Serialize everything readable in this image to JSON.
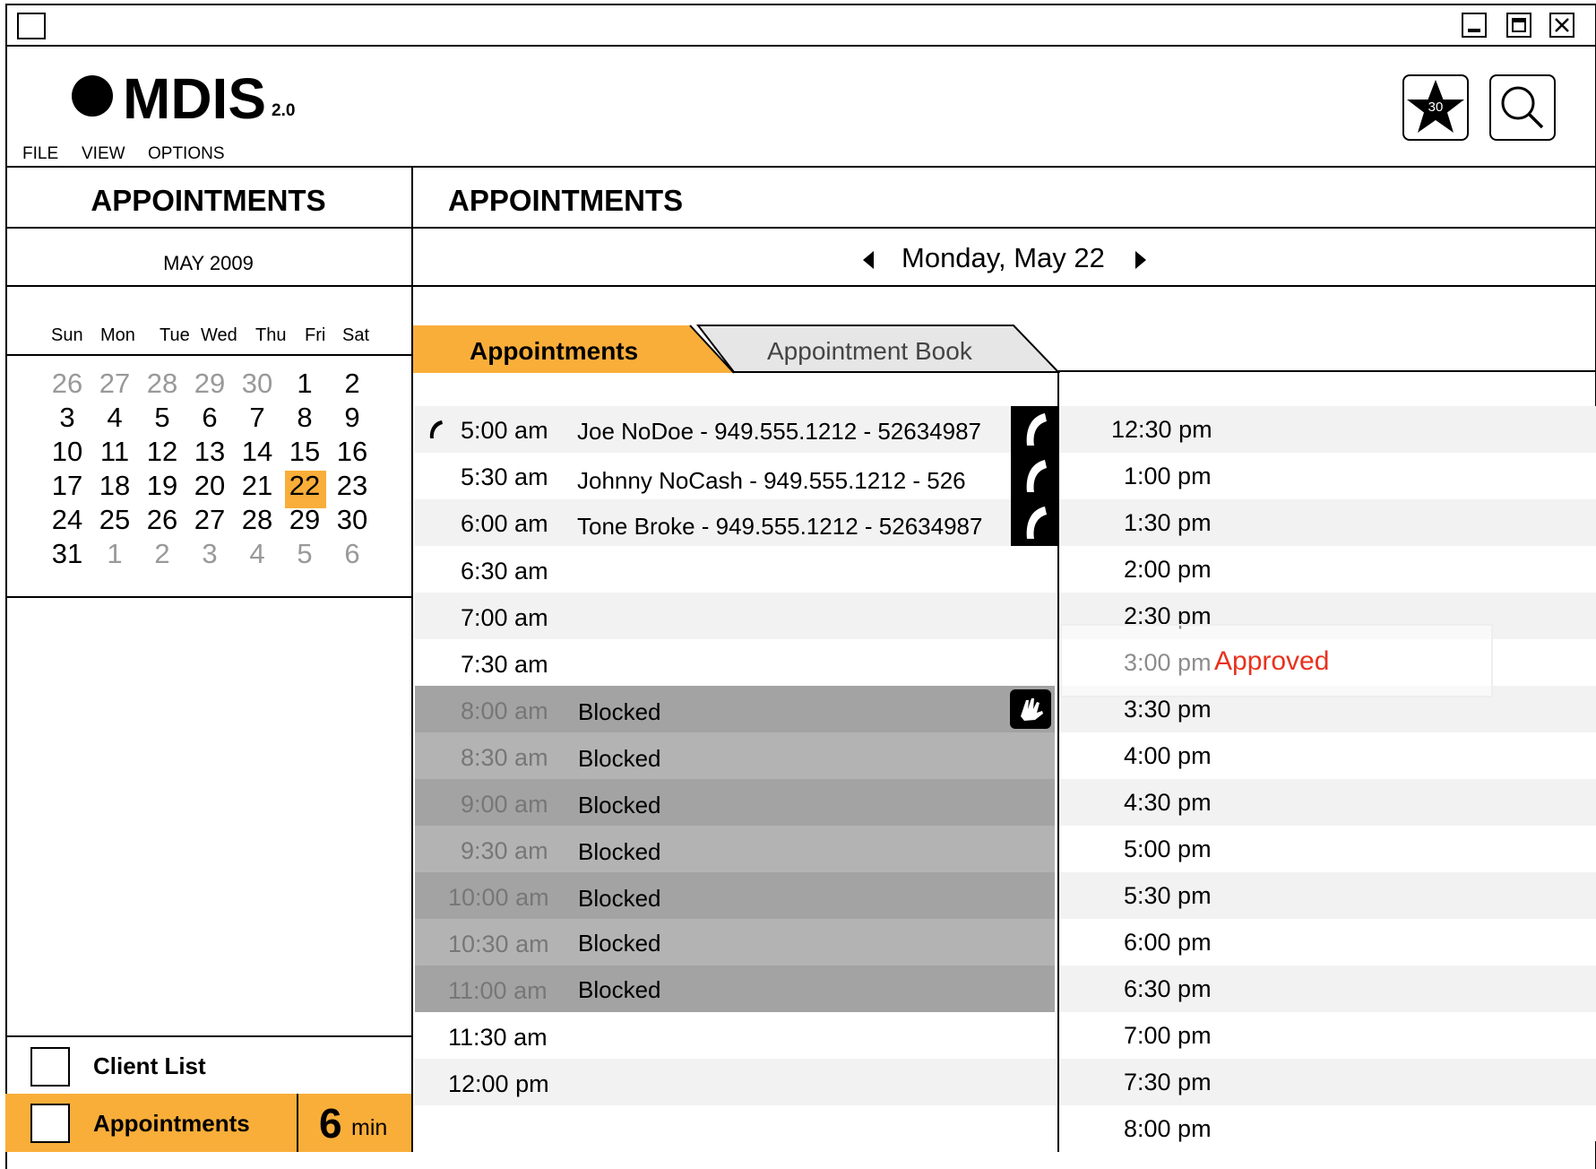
{
  "app": {
    "logo_text": "MDIS",
    "version": "2.0"
  },
  "menu": {
    "file": "FILE",
    "view": "VIEW",
    "options": "OPTIONS"
  },
  "toolbar": {
    "favorites_count": "30"
  },
  "sidebar": {
    "title": "APPOINTMENTS",
    "month": "MAY 2009",
    "weekdays": [
      "Sun",
      "Mon",
      "Tue",
      "Wed",
      "Thu",
      "Fri",
      "Sat"
    ],
    "weeks": [
      [
        "26",
        "27",
        "28",
        "29",
        "30",
        "1",
        "2"
      ],
      [
        "3",
        "4",
        "5",
        "6",
        "7",
        "8",
        "9"
      ],
      [
        "10",
        "11",
        "12",
        "13",
        "14",
        "15",
        "16"
      ],
      [
        "17",
        "18",
        "19",
        "20",
        "21",
        "22",
        "23"
      ],
      [
        "24",
        "25",
        "26",
        "27",
        "28",
        "29",
        "30"
      ],
      [
        "31",
        "1",
        "2",
        "3",
        "4",
        "5",
        "6"
      ]
    ],
    "selected_day": "22",
    "nav": {
      "client_list": "Client List",
      "appointments": "Appointments",
      "timer_value": "6",
      "timer_unit": "min"
    }
  },
  "main": {
    "title": "APPOINTMENTS",
    "date": "Monday, May 22",
    "tabs": {
      "active": "Appointments",
      "inactive": "Appointment Book"
    },
    "schedule_am": [
      {
        "time": "5:00 am",
        "name": "Joe NoDoe - 949.555.1212 - 52634987"
      },
      {
        "time": "5:30 am",
        "name": "Johnny NoCash - 949.555.1212 - 526"
      },
      {
        "time": "6:00 am",
        "name": "Tone Broke - 949.555.1212 - 52634987"
      },
      {
        "time": "6:30 am",
        "name": ""
      },
      {
        "time": "7:00 am",
        "name": ""
      },
      {
        "time": "7:30 am",
        "name": ""
      },
      {
        "time": "8:00 am",
        "name": "Blocked"
      },
      {
        "time": "8:30 am",
        "name": "Blocked"
      },
      {
        "time": "9:00 am",
        "name": "Blocked"
      },
      {
        "time": "9:30 am",
        "name": "Blocked"
      },
      {
        "time": "10:00 am",
        "name": "Blocked"
      },
      {
        "time": "10:30 am",
        "name": "Blocked"
      },
      {
        "time": "11:00 am",
        "name": "Blocked"
      },
      {
        "time": "11:30 am",
        "name": ""
      },
      {
        "time": "12:00 pm",
        "name": ""
      }
    ],
    "schedule_pm": [
      "12:30 pm",
      "1:00 pm",
      "1:30 pm",
      "2:00 pm",
      "2:30 pm",
      "3:00 pm",
      "3:30 pm",
      "4:00 pm",
      "4:30 pm",
      "5:00 pm",
      "5:30 pm",
      "6:00 pm",
      "6:30 pm",
      "7:00 pm",
      "7:30 pm",
      "8:00 pm"
    ],
    "approved_label": "Approved"
  },
  "colors": {
    "accent": "#F9AE3A",
    "approved": "#E8321E",
    "blocked_dark": "#A3A3A3",
    "blocked_light": "#B3B3B3",
    "stripe": "#F2F2F2"
  }
}
